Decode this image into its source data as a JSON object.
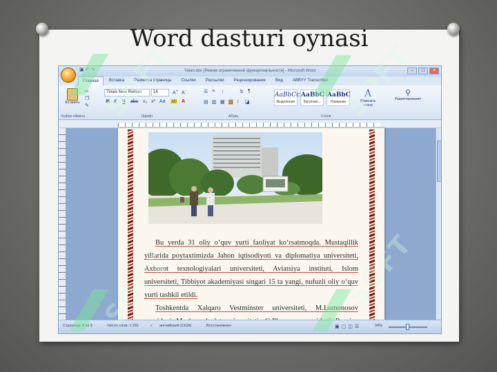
{
  "slide": {
    "title": "Word dasturi oynasi"
  },
  "window": {
    "title": "Yalan.doc [Режим ограниченной функциональности] - Microsoft Word",
    "qat_icons": [
      "save-icon",
      "undo-icon",
      "redo-icon"
    ],
    "controls": [
      "–",
      "□",
      "×"
    ]
  },
  "ribbon": {
    "tabs": [
      "Главная",
      "Вставка",
      "Разметка страницы",
      "Ссылки",
      "Рассылки",
      "Рецензирование",
      "Вид",
      "ABBYY Transcriber"
    ],
    "active_tab": "Главная",
    "clipboard": {
      "paste_label": "Вставить",
      "group_label": "Буфер обмена"
    },
    "font": {
      "name": "Times New Roman",
      "size": "14",
      "group_label": "Шрифт"
    },
    "paragraph": {
      "group_label": "Абзац"
    },
    "styles": {
      "items": [
        {
          "sample": "AaBbCcI",
          "name": "Выделение"
        },
        {
          "sample": "AaBbC",
          "name": "Заголово..."
        },
        {
          "sample": "AaBbC",
          "name": "Название"
        }
      ],
      "change_label": "Изменить стили",
      "group_label": "Стили"
    },
    "editing": {
      "label": "Редактирование"
    }
  },
  "document": {
    "paragraphs": [
      "Bu yerda 31 oliy o‘quv yurti faoliyat ko‘rsatmoqda. Mustaqillik yillarida poytaxtimizda Jahon iqtisodiyoti va diplomatiya universiteti, Axborot texnologiyalari universiteti, Aviatsiya instituti, Islom universiteti, Tibbiyot akademiyasi singari 15 ta yangi, nufuzli oliy o‘quv yurti tashkil etildi.",
      "Toshkentda Xalqaro Vestminster universiteti, M.Lomonosov nomidagi Moskva davlat universiteti, G.Plexanov nomidagi Rossiya iqtisodiyot"
    ]
  },
  "status": {
    "page": "Страница: 8 из 9",
    "words": "Число слов: 1 291",
    "language": "английский (США)",
    "mode": "Восстановлен",
    "zoom": "94%"
  },
  "watermark": {
    "text": "SOFT"
  },
  "colors": {
    "ribbon_bg": "#dde8f5",
    "page_border": "#b02e1f",
    "watermark": "#9ef0b0"
  }
}
